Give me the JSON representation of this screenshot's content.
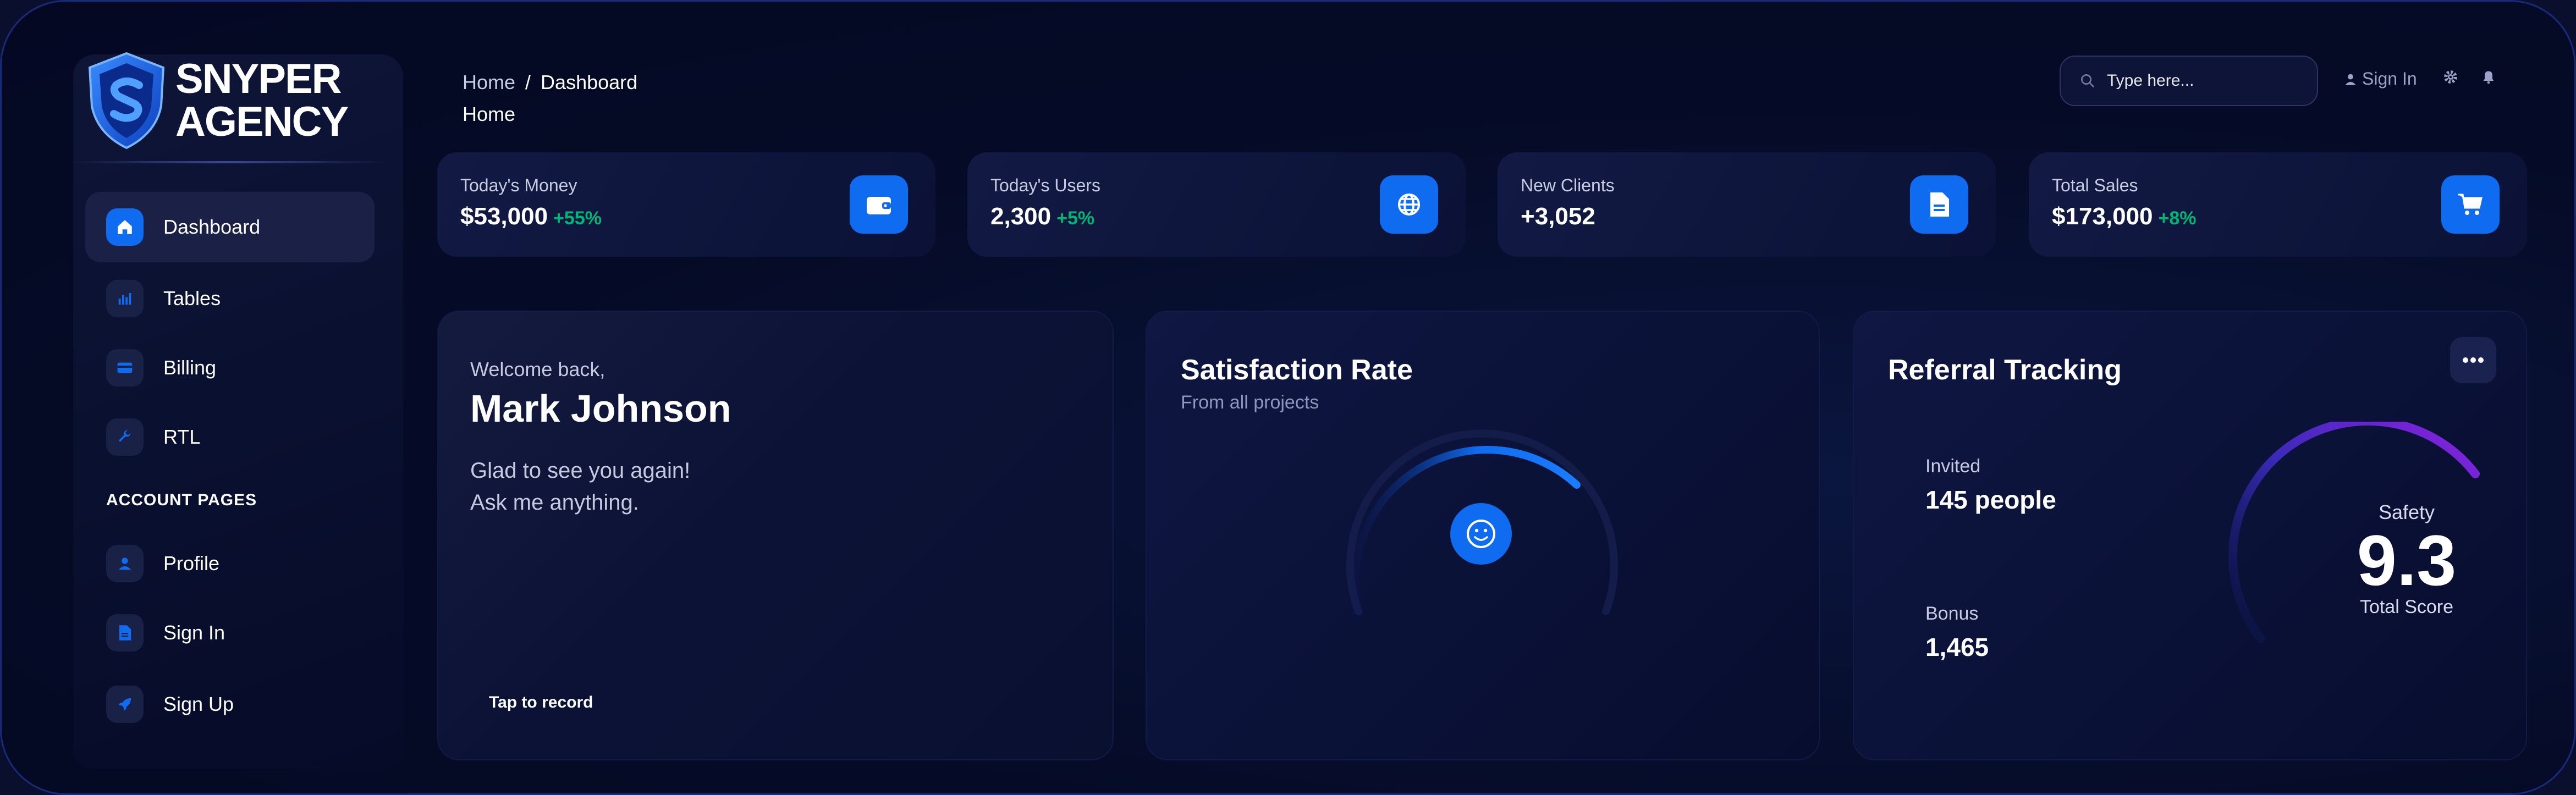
{
  "brand": {
    "line1": "SNYPER",
    "line2": "AGENCY"
  },
  "sidebar": {
    "items": [
      {
        "label": "Dashboard",
        "icon": "home-icon"
      },
      {
        "label": "Tables",
        "icon": "bar-chart-icon"
      },
      {
        "label": "Billing",
        "icon": "credit-card-icon"
      },
      {
        "label": "RTL",
        "icon": "wrench-icon"
      }
    ],
    "section_title": "ACCOUNT PAGES",
    "account_items": [
      {
        "label": "Profile",
        "icon": "person-icon"
      },
      {
        "label": "Sign In",
        "icon": "document-icon"
      },
      {
        "label": "Sign Up",
        "icon": "rocket-icon"
      }
    ]
  },
  "header": {
    "breadcrumb_home": "Home",
    "breadcrumb_sep": "/",
    "breadcrumb_current": "Dashboard",
    "page_title": "Home",
    "search_placeholder": "Type here...",
    "sign_in": "Sign In"
  },
  "stats": [
    {
      "label": "Today's Money",
      "value": "$53,000",
      "change": "+55%",
      "icon": "wallet-icon"
    },
    {
      "label": "Today's Users",
      "value": "2,300",
      "change": "+5%",
      "icon": "globe-icon"
    },
    {
      "label": "New Clients",
      "value": "+3,052",
      "change": "",
      "icon": "document-icon"
    },
    {
      "label": "Total Sales",
      "value": "$173,000",
      "change": "+8%",
      "icon": "cart-icon"
    }
  ],
  "welcome": {
    "greeting": "Welcome back,",
    "name": "Mark Johnson",
    "line1": "Glad to see you again!",
    "line2": "Ask me anything.",
    "tap": "Tap to record"
  },
  "satisfaction": {
    "title": "Satisfaction Rate",
    "subtitle": "From all projects",
    "icon": "smiley-icon"
  },
  "referral": {
    "title": "Referral Tracking",
    "invited_label": "Invited",
    "invited_value": "145 people",
    "bonus_label": "Bonus",
    "bonus_value": "1,465",
    "gauge_label": "Safety",
    "score": "9.3",
    "score_label": "Total Score"
  },
  "colors": {
    "accent": "#0f6cf0",
    "positive": "#01b574",
    "gauge_purple": "#7a2ad6"
  }
}
